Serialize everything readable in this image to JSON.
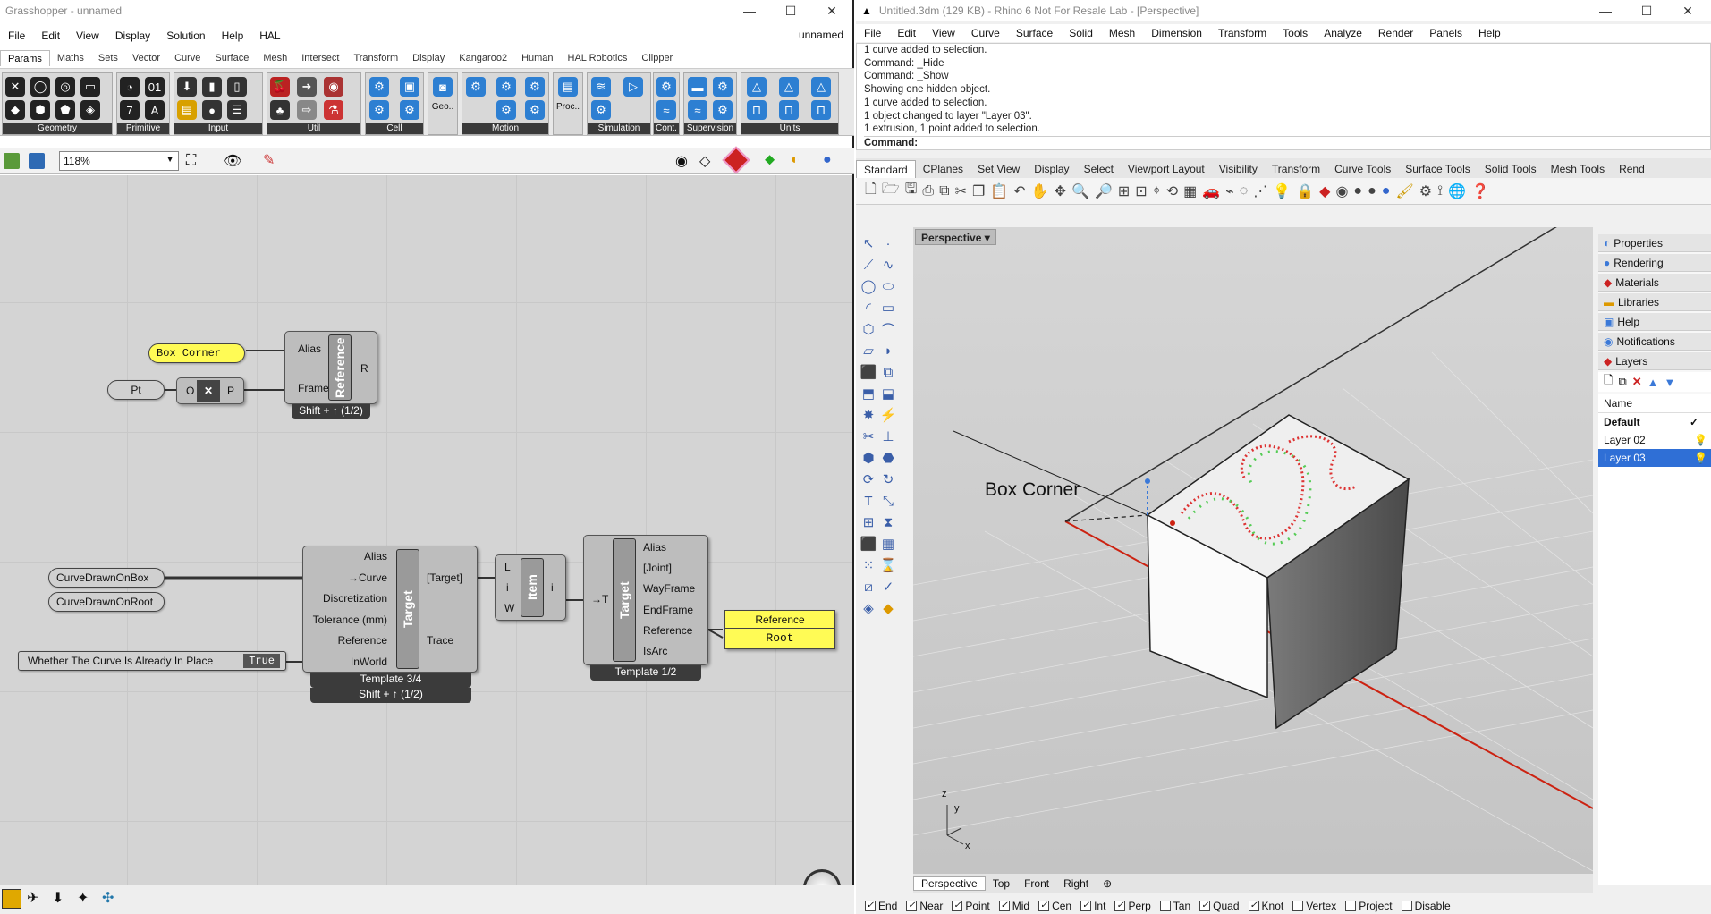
{
  "grasshopper": {
    "title": "Grasshopper - unnamed",
    "doc_name": "unnamed",
    "menu": [
      "File",
      "Edit",
      "View",
      "Display",
      "Solution",
      "Help",
      "HAL"
    ],
    "tabs": [
      "Params",
      "Maths",
      "Sets",
      "Vector",
      "Curve",
      "Surface",
      "Mesh",
      "Intersect",
      "Transform",
      "Display",
      "Kangaroo2",
      "Human",
      "HAL Robotics",
      "Clipper"
    ],
    "active_tab": "Params",
    "ribbon_groups": [
      "Geometry",
      "Primitive",
      "Input",
      "Util",
      "Cell",
      "Motion",
      "Simulation",
      "Cont.",
      "Supervision",
      "Units"
    ],
    "ribbon_extra": [
      "Geo..",
      "Proc.."
    ],
    "zoom": "118%",
    "canvas": {
      "box_corner_panel": "Box Corner",
      "pt_label": "Pt",
      "xform_ports": {
        "in": "O",
        "out": "P"
      },
      "ref_component": {
        "inputs": [
          "Alias",
          "Frame"
        ],
        "name": "Reference",
        "output": "R",
        "tag": "Shift + ↑ (1/2)"
      },
      "curve_params": [
        "CurveDrawnOnBox",
        "CurveDrawnOnRoot"
      ],
      "toggle": {
        "label": "Whether The Curve Is Already In Place",
        "value": "True"
      },
      "target_comp_1": {
        "inputs": [
          "Alias",
          "→Curve",
          "Discretization",
          "Tolerance (mm)",
          "Reference",
          "InWorld"
        ],
        "name": "Target",
        "outputs": [
          "[Target]",
          "Trace"
        ],
        "tag1": "Template 3/4",
        "tag2": "Shift + ↑ (1/2)"
      },
      "item_comp": {
        "inputs": [
          "L",
          "i",
          "W"
        ],
        "name": "Item",
        "output": "i"
      },
      "target_comp_2": {
        "input": "→T",
        "name": "Target",
        "outputs": [
          "Alias",
          "[Joint]",
          "WayFrame",
          "EndFrame",
          "Reference",
          "IsArc"
        ],
        "tag": "Template 1/2"
      },
      "panel_out": {
        "header": "Reference",
        "value": "Root"
      }
    }
  },
  "rhino": {
    "title": "Untitled.3dm (129 KB) - Rhino 6 Not For Resale Lab - [Perspective]",
    "menu": [
      "File",
      "Edit",
      "View",
      "Curve",
      "Surface",
      "Solid",
      "Mesh",
      "Dimension",
      "Transform",
      "Tools",
      "Analyze",
      "Render",
      "Panels",
      "Help"
    ],
    "command_history": [
      "1 curve added to selection.",
      "Command: _Hide",
      "Command: _Show",
      "Showing one hidden object.",
      "1 curve added to selection.",
      "1 object changed to layer \"Layer 03\".",
      "1 extrusion, 1 point added to selection."
    ],
    "command_prompt": "Command:",
    "toolbar_tabs": [
      "Standard",
      "CPlanes",
      "Set View",
      "Display",
      "Select",
      "Viewport Layout",
      "Visibility",
      "Transform",
      "Curve Tools",
      "Surface Tools",
      "Solid Tools",
      "Mesh Tools",
      "Rend"
    ],
    "active_toolbar_tab": "Standard",
    "viewport": {
      "name": "Perspective",
      "annotation": "Box Corner",
      "axes": [
        "z",
        "y",
        "x"
      ]
    },
    "panels": [
      "Properties",
      "Rendering",
      "Materials",
      "Libraries",
      "Help",
      "Notifications",
      "Layers"
    ],
    "layers": {
      "header": "Name",
      "items": [
        {
          "name": "Default",
          "current": true
        },
        {
          "name": "Layer 02"
        },
        {
          "name": "Layer 03",
          "selected": true
        }
      ]
    },
    "view_tabs": [
      "Perspective",
      "Top",
      "Front",
      "Right"
    ],
    "osnaps": [
      {
        "name": "End",
        "on": true
      },
      {
        "name": "Near",
        "on": true
      },
      {
        "name": "Point",
        "on": true
      },
      {
        "name": "Mid",
        "on": true
      },
      {
        "name": "Cen",
        "on": true
      },
      {
        "name": "Int",
        "on": true
      },
      {
        "name": "Perp",
        "on": true
      },
      {
        "name": "Tan",
        "on": false
      },
      {
        "name": "Quad",
        "on": true
      },
      {
        "name": "Knot",
        "on": true
      },
      {
        "name": "Vertex",
        "on": false
      },
      {
        "name": "Project",
        "on": false
      },
      {
        "name": "Disable",
        "on": false
      }
    ]
  }
}
